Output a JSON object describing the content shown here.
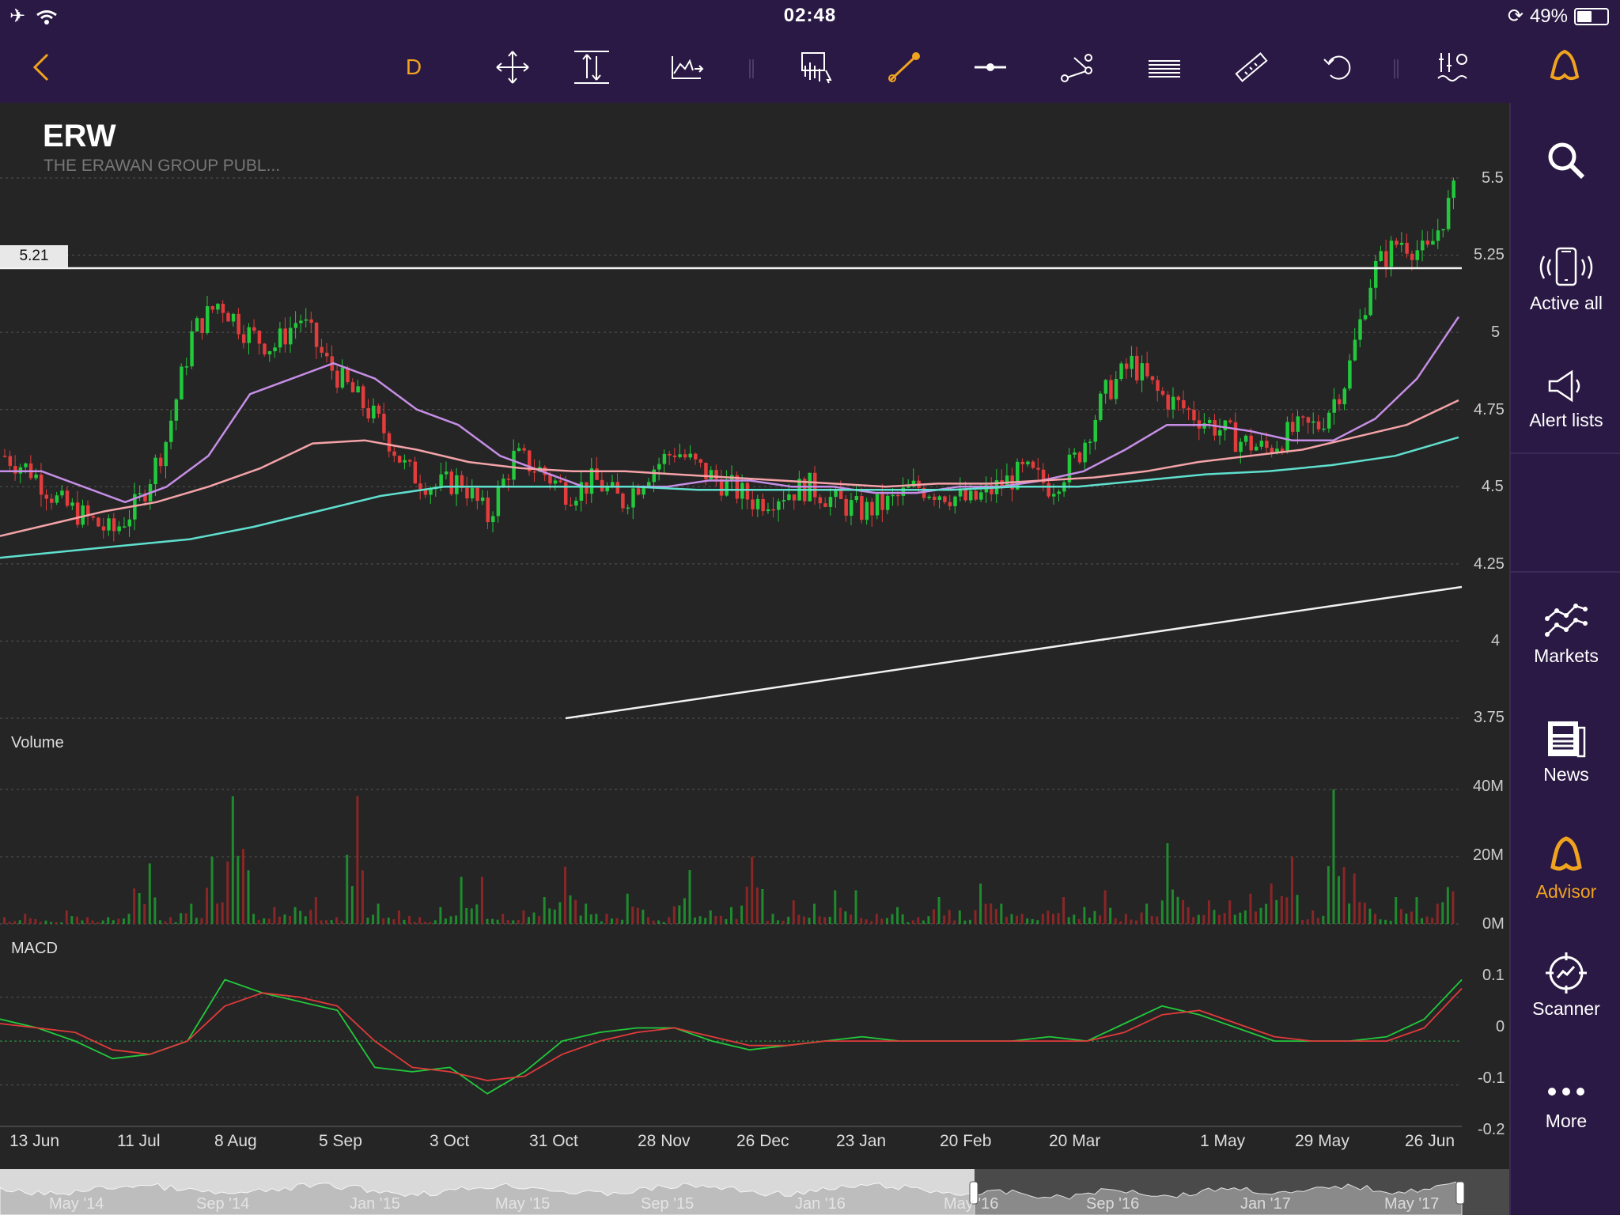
{
  "status_bar": {
    "time": "02:48",
    "battery": "49%"
  },
  "toolbar": {
    "timeframe": "D"
  },
  "stock": {
    "ticker": "ERW",
    "company": "THE ERAWAN GROUP PUBL..."
  },
  "price_marker": "5.21",
  "sidebar": {
    "items": [
      {
        "label": ""
      },
      {
        "label": "Active all"
      },
      {
        "label": "Alert lists"
      },
      {
        "label": "Markets"
      },
      {
        "label": "News"
      },
      {
        "label": "Advisor"
      },
      {
        "label": "Scanner"
      },
      {
        "label": "More"
      }
    ]
  },
  "colors": {
    "accent": "#f0a31f",
    "up": "#22c93c",
    "down": "#e23c3c",
    "bar_bg": "#2a1944"
  },
  "chart_data": [
    {
      "type": "candlestick",
      "title": "ERW",
      "x_labels": [
        "13 Jun",
        "11 Jul",
        "8 Aug",
        "5 Sep",
        "3 Oct",
        "31 Oct",
        "28 Nov",
        "26 Dec",
        "23 Jan",
        "20 Feb",
        "20 Mar",
        "1 May",
        "29 May",
        "26 Jun"
      ],
      "y_ticks": [
        "5.5",
        "5.25",
        "5",
        "4.75",
        "4.5",
        "4.25",
        "4",
        "3.75"
      ],
      "ylim": [
        3.75,
        5.5
      ],
      "horizontal_line": 5.21,
      "trend_line": {
        "from": 3.75,
        "to": 4.18
      },
      "close_series": [
        4.6,
        4.55,
        4.45,
        4.4,
        4.35,
        4.45,
        4.65,
        5.0,
        5.1,
        5.0,
        4.95,
        5.05,
        4.9,
        4.8,
        4.7,
        4.55,
        4.5,
        4.52,
        4.4,
        4.6,
        4.55,
        4.48,
        4.52,
        4.45,
        4.55,
        4.62,
        4.55,
        4.5,
        4.45,
        4.48,
        4.5,
        4.45,
        4.42,
        4.45,
        4.5,
        4.48,
        4.45,
        4.5,
        4.55,
        4.5,
        4.6,
        4.8,
        4.9,
        4.8,
        4.75,
        4.7,
        4.65,
        4.62,
        4.68,
        4.7,
        4.85,
        5.2,
        5.3,
        5.25,
        5.45
      ],
      "moving_averages": [
        {
          "name": "",
          "color": "#c68ee6",
          "values": [
            4.55,
            4.55,
            4.5,
            4.45,
            4.5,
            4.6,
            4.8,
            4.85,
            4.9,
            4.85,
            4.75,
            4.7,
            4.6,
            4.55,
            4.5,
            4.5,
            4.5,
            4.52,
            4.52,
            4.5,
            4.5,
            4.48,
            4.48,
            4.5,
            4.5,
            4.52,
            4.55,
            4.62,
            4.7,
            4.7,
            4.68,
            4.65,
            4.65,
            4.72,
            4.85,
            5.05
          ]
        },
        {
          "name": "",
          "color": "#f4a3a8",
          "values": [
            4.34,
            4.38,
            4.42,
            4.45,
            4.5,
            4.56,
            4.64,
            4.65,
            4.62,
            4.58,
            4.56,
            4.55,
            4.55,
            4.54,
            4.53,
            4.52,
            4.51,
            4.5,
            4.51,
            4.51,
            4.52,
            4.53,
            4.55,
            4.58,
            4.6,
            4.62,
            4.66,
            4.7,
            4.78
          ]
        },
        {
          "name": "",
          "color": "#5fe0cf",
          "values": [
            4.27,
            4.29,
            4.31,
            4.33,
            4.37,
            4.42,
            4.47,
            4.5,
            4.5,
            4.5,
            4.5,
            4.49,
            4.49,
            4.49,
            4.49,
            4.49,
            4.5,
            4.5,
            4.52,
            4.54,
            4.55,
            4.57,
            4.6,
            4.66
          ]
        }
      ]
    },
    {
      "type": "bar",
      "title": "Volume",
      "y_ticks": [
        "40M",
        "20M",
        "0M"
      ],
      "ylim": [
        0,
        40
      ],
      "values": [
        2,
        3,
        1,
        4,
        2,
        3,
        18,
        2,
        6,
        20,
        38,
        3,
        5,
        8,
        2,
        38,
        6,
        4,
        2,
        5,
        14,
        3,
        4,
        8,
        17,
        6,
        3,
        9,
        2,
        16,
        4,
        5,
        20,
        3,
        7,
        6,
        10,
        3,
        5,
        2,
        8,
        4,
        12,
        6,
        3,
        8,
        5,
        10,
        3,
        6,
        24,
        5,
        7,
        9,
        12,
        20,
        4,
        40,
        15,
        3,
        8,
        6,
        22
      ]
    },
    {
      "type": "line",
      "title": "MACD",
      "y_ticks": [
        "0.1",
        "0",
        "-0.1",
        "-0.2"
      ],
      "ylim": [
        -0.2,
        0.15
      ],
      "series": [
        {
          "name": "",
          "color": "#22c93c",
          "values": [
            0.05,
            0.03,
            0.0,
            -0.04,
            -0.03,
            0.0,
            0.14,
            0.11,
            0.09,
            0.07,
            -0.06,
            -0.07,
            -0.06,
            -0.12,
            -0.07,
            0.0,
            0.02,
            0.03,
            0.03,
            0.0,
            -0.02,
            -0.01,
            0.0,
            0.01,
            0.0,
            0.0,
            0.0,
            0.0,
            0.01,
            0.0,
            0.04,
            0.08,
            0.06,
            0.03,
            0.0,
            0.0,
            0.0,
            0.01,
            0.05,
            0.14
          ]
        },
        {
          "name": "",
          "color": "#e03a3a",
          "values": [
            0.04,
            0.03,
            0.02,
            -0.02,
            -0.03,
            0.0,
            0.08,
            0.11,
            0.1,
            0.08,
            0.0,
            -0.06,
            -0.07,
            -0.09,
            -0.08,
            -0.03,
            0.0,
            0.02,
            0.03,
            0.01,
            -0.01,
            -0.01,
            0.0,
            0.0,
            0.0,
            0.0,
            0.0,
            0.0,
            0.0,
            0.0,
            0.02,
            0.06,
            0.07,
            0.04,
            0.01,
            0.0,
            0.0,
            0.0,
            0.03,
            0.12
          ]
        }
      ]
    }
  ],
  "navigator": {
    "labels": [
      "May '14",
      "Sep '14",
      "Jan '15",
      "May '15",
      "Sep '15",
      "Jan '16",
      "May '16",
      "Sep '16",
      "Jan '17",
      "May '17"
    ]
  }
}
